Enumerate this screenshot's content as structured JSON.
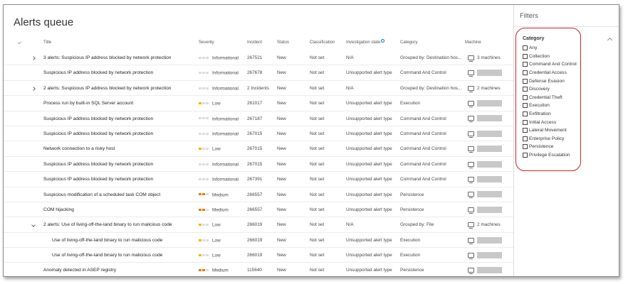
{
  "page_title": "Alerts queue",
  "columns": {
    "title": "Title",
    "severity": "Severity",
    "incident": "Incident",
    "status": "Status",
    "classification": "Classification",
    "investigation": "Investigation state",
    "category": "Category",
    "machine": "Machine"
  },
  "rows": [
    {
      "title": "3 alerts: Suspicious IP address blocked by network protection",
      "severity": "Informational",
      "incident": "267521",
      "status": "New",
      "classification": "Not set",
      "investigation": "N/A",
      "category": "Grouped by: Destination hos...",
      "machine": "3 machines"
    },
    {
      "title": "Suspicious IP address blocked by network protection",
      "severity": "Informational",
      "incident": "267678",
      "status": "New",
      "classification": "Not set",
      "investigation": "Unsupported alert type",
      "category": "Command And Control",
      "machine": ""
    },
    {
      "title": "2 alerts: Suspicious IP address blocked by network protection",
      "severity": "Informational",
      "incident": "2 Incidents",
      "status": "New",
      "classification": "Not set",
      "investigation": "N/A",
      "category": "Grouped by: Destination hos...",
      "machine": "2 machines"
    },
    {
      "title": "Process run by built-in SQL Server account",
      "severity": "Low",
      "incident": "261017",
      "status": "New",
      "classification": "Not set",
      "investigation": "Unsupported alert type",
      "category": "Execution",
      "machine": ""
    },
    {
      "title": "Suspicious IP address blocked by network protection",
      "severity": "Informational",
      "incident": "267187",
      "status": "New",
      "classification": "Not set",
      "investigation": "Unsupported alert type",
      "category": "Command And Control",
      "machine": ""
    },
    {
      "title": "Suspicious IP address blocked by network protection",
      "severity": "Informational",
      "incident": "267015",
      "status": "New",
      "classification": "Not set",
      "investigation": "Unsupported alert type",
      "category": "Command And Control",
      "machine": ""
    },
    {
      "title": "Network connection to a risky host",
      "severity": "Low",
      "incident": "267015",
      "status": "New",
      "classification": "Not set",
      "investigation": "Unsupported alert type",
      "category": "Command And Control",
      "machine": ""
    },
    {
      "title": "Suspicious IP address blocked by network protection",
      "severity": "Informational",
      "incident": "267015",
      "status": "New",
      "classification": "Not set",
      "investigation": "Unsupported alert type",
      "category": "Command And Control",
      "machine": ""
    },
    {
      "title": "Suspicious IP address blocked by network protection",
      "severity": "Informational",
      "incident": "267391",
      "status": "New",
      "classification": "Not set",
      "investigation": "Unsupported alert type",
      "category": "Command And Control",
      "machine": ""
    },
    {
      "title": "Suspicious modification of a scheduled task COM object",
      "severity": "Medium",
      "incident": "266557",
      "status": "New",
      "classification": "Not set",
      "investigation": "Unsupported alert type",
      "category": "Persistence",
      "machine": ""
    },
    {
      "title": "COM hijacking",
      "severity": "Medium",
      "incident": "266557",
      "status": "New",
      "classification": "Not set",
      "investigation": "Unsupported alert type",
      "category": "Persistence",
      "machine": ""
    },
    {
      "title": "2 alerts: Use of living-off-the-land binary to run malicious code",
      "severity": "Low",
      "incident": "266019",
      "status": "New",
      "classification": "Not set",
      "investigation": "N/A",
      "category": "Grouped by: File",
      "machine": "2 machines"
    },
    {
      "title": "Use of living-off-the-land binary to run malicious code",
      "severity": "Low",
      "incident": "266019",
      "status": "New",
      "classification": "Not set",
      "investigation": "Unsupported alert type",
      "category": "Execution",
      "machine": ""
    },
    {
      "title": "Use of living-off-the-land binary to run malicious code",
      "severity": "Low",
      "incident": "266019",
      "status": "New",
      "classification": "Not set",
      "investigation": "Unsupported alert type",
      "category": "Execution",
      "machine": ""
    },
    {
      "title": "Anomaly detected in ASEP registry",
      "severity": "Medium",
      "incident": "115640",
      "status": "New",
      "classification": "Not set",
      "investigation": "Unsupported alert type",
      "category": "Persistence",
      "machine": ""
    }
  ],
  "filters": {
    "title": "Filters",
    "category_heading": "Category",
    "categories": [
      "Any",
      "Collection",
      "Command And Control",
      "Credential Access",
      "Defense Evasion",
      "Discovery",
      "Credential Theft",
      "Execution",
      "Exfiltration",
      "Initial Access",
      "Lateral Movement",
      "Enterprise Policy",
      "Persistence",
      "Privilege Escalation"
    ]
  },
  "colors": {
    "severity_low": "#f2b500",
    "severity_medium": "#e67e00",
    "highlight_oval": "#c0262d"
  }
}
